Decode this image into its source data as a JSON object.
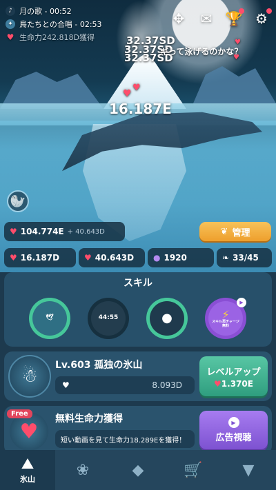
{
  "hud": {
    "song": "月の歌 - 00:52",
    "choir": "鳥たちとの合唱 - 02:53",
    "life_power": "生命力242.818D獲得"
  },
  "top_icons": [
    "move-icon",
    "mail-icon",
    "trophy-icon",
    "gear-icon"
  ],
  "floating": {
    "text1": "32.37SD",
    "text2": "32.37SD",
    "text3": "32.37SD",
    "question": "ギって泳げるのかな？",
    "total": "16.187E"
  },
  "stats": {
    "life": "104.774E",
    "life_rate": "+ 40.643D",
    "tap": "16.187D",
    "per_sec": "40.643D",
    "pearls": "1920",
    "feathers": "33/45",
    "manage_label": "管理"
  },
  "skills": {
    "title": "スキル",
    "timer": "44:55",
    "charge_label": "スキル再チャージ",
    "charge_sub": "無料"
  },
  "level": {
    "title": "Lv.603 孤独の氷山",
    "value": "8.093D",
    "button": "レベルアップ",
    "cost": "1.370E"
  },
  "free": {
    "badge": "Free",
    "title": "無料生命力獲得",
    "desc": "短い動画を見て生命力18.289Eを獲得！",
    "button": "広告視聴"
  },
  "nav": {
    "active_label": "氷山"
  },
  "colors": {
    "accent_orange": "#ee9f2c",
    "accent_green": "#2f9e7f",
    "accent_purple": "#7d52d1",
    "heart": "#ff4d6b"
  }
}
